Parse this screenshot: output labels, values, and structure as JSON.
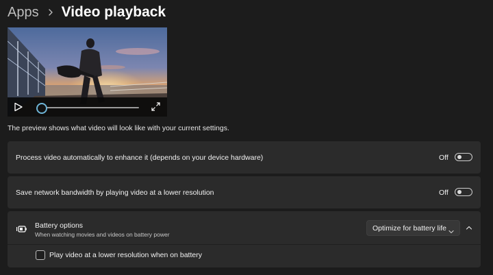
{
  "breadcrumb": {
    "parent": "Apps",
    "current": "Video playback"
  },
  "video_preview": {
    "progress": 0.0,
    "play_icon": "play-icon",
    "fullscreen_icon": "fullscreen-icon",
    "thumb_color": "#6fb6d8"
  },
  "preview_caption": "The preview shows what video will look like with your current settings.",
  "settings": [
    {
      "label": "Process video automatically to enhance it (depends on your device hardware)",
      "state_label": "Off",
      "enabled": false
    },
    {
      "label": "Save network bandwidth by playing video at a lower resolution",
      "state_label": "Off",
      "enabled": false
    }
  ],
  "battery": {
    "icon": "battery-saver-icon",
    "title": "Battery options",
    "subtitle": "When watching movies and videos on battery power",
    "dropdown_value": "Optimize for battery life",
    "expanded": true,
    "checkbox_label": "Play video at a lower resolution when on battery",
    "checkbox_checked": false
  },
  "colors": {
    "background": "#1c1c1c",
    "card": "#2b2b2b",
    "accent": "#6fb6d8"
  }
}
